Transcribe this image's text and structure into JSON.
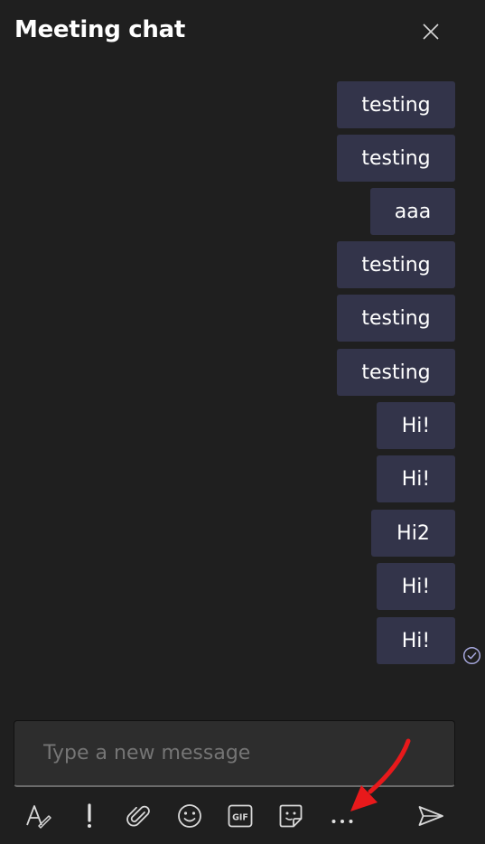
{
  "header": {
    "title": "Meeting chat"
  },
  "messages": [
    {
      "text": "testing"
    },
    {
      "text": "testing"
    },
    {
      "text": "aaa"
    },
    {
      "text": "testing"
    },
    {
      "text": "testing"
    },
    {
      "text": "testing"
    },
    {
      "text": "Hi!"
    },
    {
      "text": "Hi!"
    },
    {
      "text": "Hi2"
    },
    {
      "text": "Hi!"
    },
    {
      "text": "Hi!"
    }
  ],
  "compose": {
    "placeholder": "Type a new message"
  },
  "toolbar": {
    "gif_label": "GIF",
    "items": [
      "format-icon",
      "important-icon",
      "attach-icon",
      "emoji-icon",
      "gif-icon",
      "sticker-icon",
      "more-options-icon",
      "send-icon"
    ]
  },
  "colors": {
    "background": "#1f1f1f",
    "bubble": "#33344a",
    "accent": "#a6a7dc",
    "annotation_arrow": "#e8191b"
  }
}
